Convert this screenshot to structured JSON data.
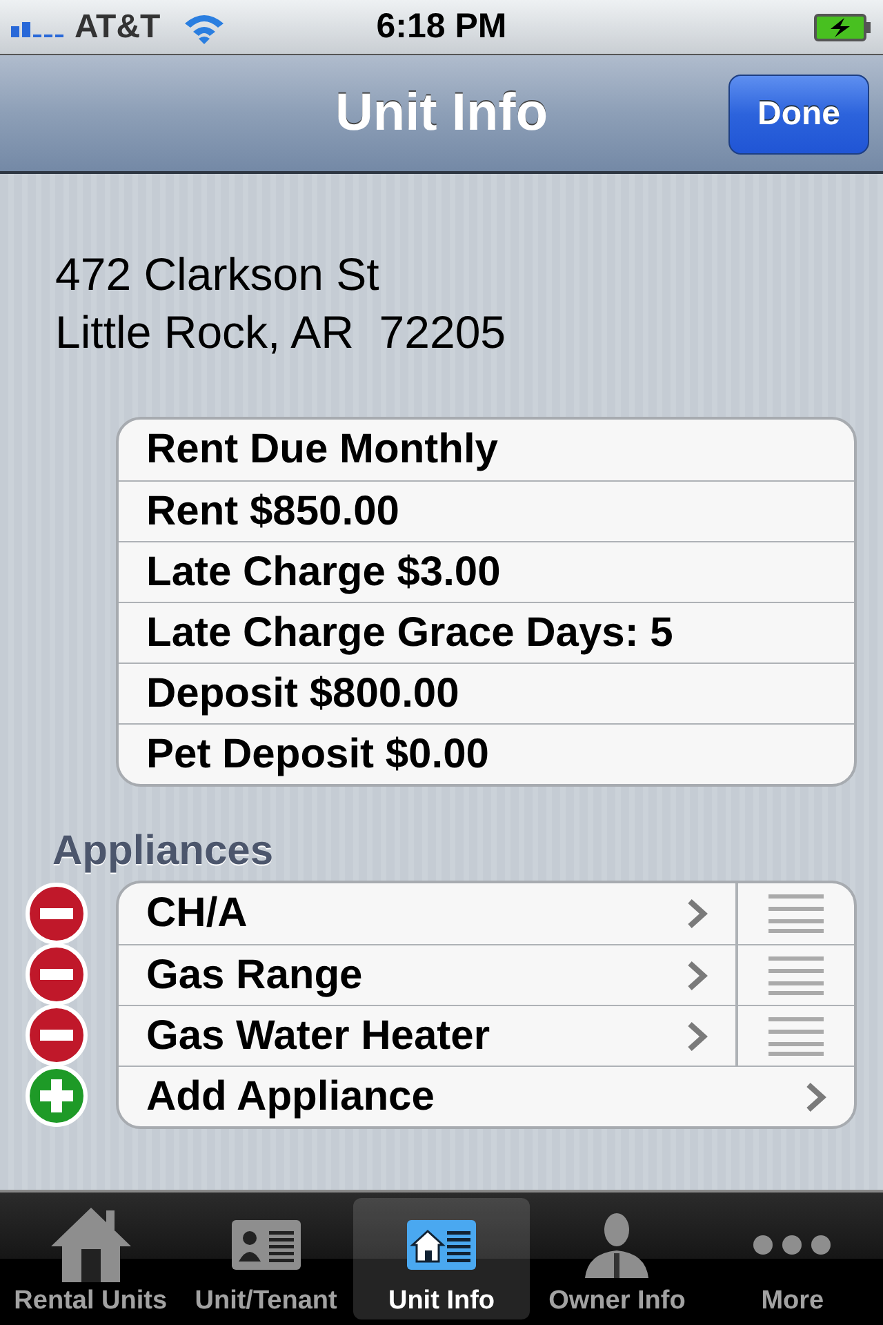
{
  "status_bar": {
    "carrier": "AT&T",
    "time": "6:18 PM"
  },
  "nav_bar": {
    "title": "Unit Info",
    "done_button": "Done"
  },
  "address": {
    "street": "472 Clarkson St",
    "city_line": "Little Rock, AR  72205"
  },
  "rent_details": [
    "Rent Due Monthly",
    "Rent $850.00",
    "Late Charge $3.00",
    "Late Charge Grace Days: 5",
    "Deposit $800.00",
    "Pet Deposit $0.00"
  ],
  "appliances": {
    "header": "Appliances",
    "rows": [
      {
        "kind": "delete",
        "label": "CH/A"
      },
      {
        "kind": "delete",
        "label": "Gas Range"
      },
      {
        "kind": "delete",
        "label": "Gas Water Heater"
      },
      {
        "kind": "add",
        "label": "Add Appliance"
      }
    ]
  },
  "tab_bar": [
    {
      "kind": "house",
      "label": "Rental Units",
      "selected": false
    },
    {
      "kind": "card",
      "label": "Unit/Tenant",
      "selected": false
    },
    {
      "kind": "house-card",
      "label": "Unit Info",
      "selected": true
    },
    {
      "kind": "person",
      "label": "Owner Info",
      "selected": false
    },
    {
      "kind": "dots",
      "label": "More",
      "selected": false
    }
  ]
}
